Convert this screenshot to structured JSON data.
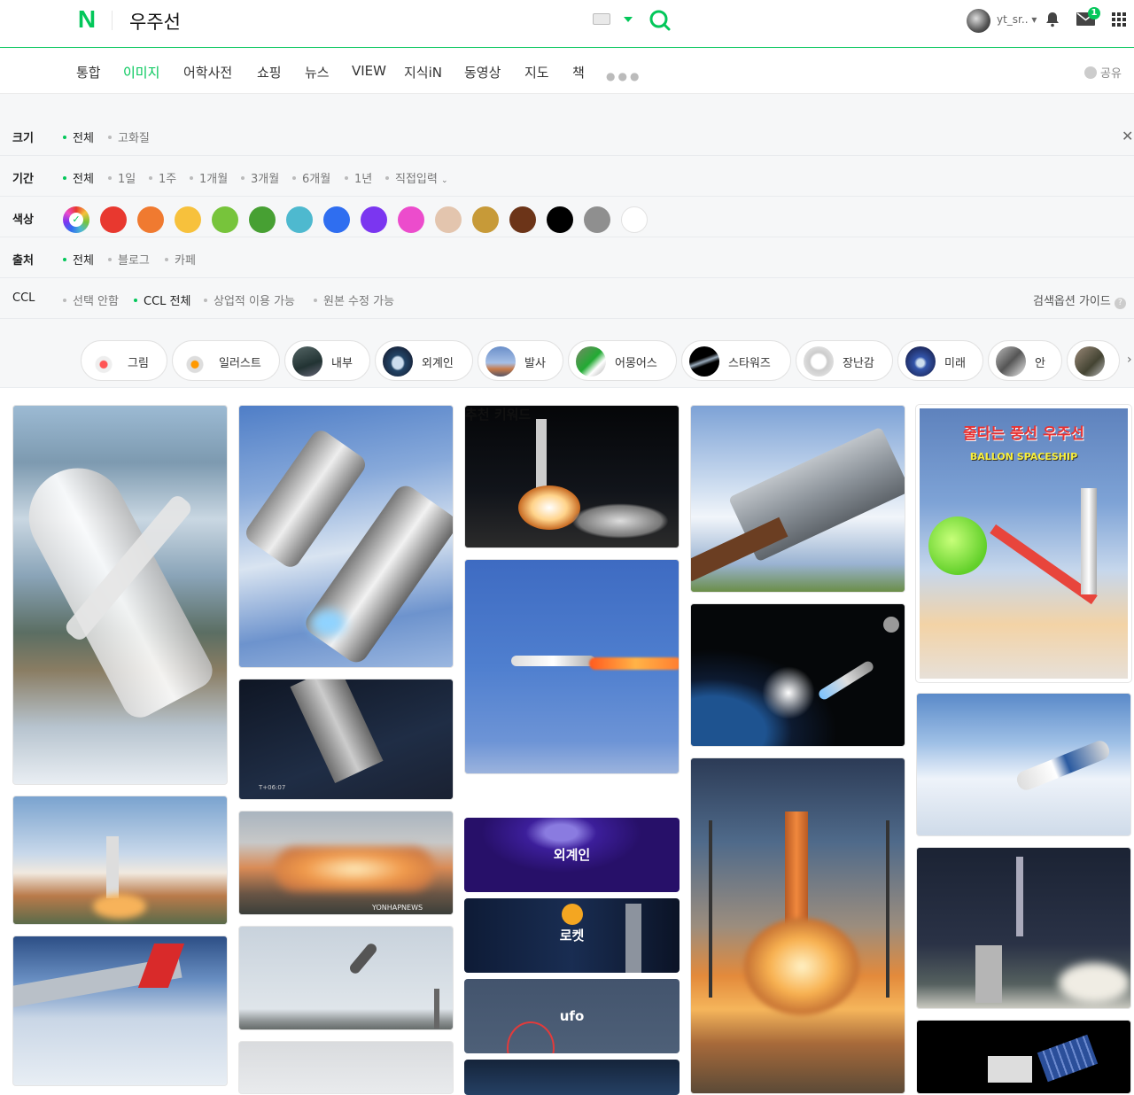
{
  "header": {
    "logo": "N",
    "query": "우주선",
    "user_id": "yt_sr..",
    "mail_count": "1"
  },
  "tabs": [
    "통합",
    "이미지",
    "어학사전",
    "쇼핑",
    "뉴스",
    "VIEW",
    "지식iN",
    "동영상",
    "지도",
    "책"
  ],
  "share_label": "공유",
  "options": {
    "size": {
      "label": "크기",
      "items": [
        "전체",
        "고화질"
      ]
    },
    "period": {
      "label": "기간",
      "items": [
        "전체",
        "1일",
        "1주",
        "1개월",
        "3개월",
        "6개월",
        "1년",
        "직접입력"
      ]
    },
    "color": {
      "label": "색상",
      "swatches": [
        "#e8382f",
        "#f07a30",
        "#f7c13c",
        "#77c43b",
        "#47a033",
        "#4eb9cf",
        "#2f6ef0",
        "#7b36f0",
        "#ec4ccc",
        "#e3c5ae",
        "#c79a38",
        "#6c3418",
        "#000000",
        "#8f8f8f",
        "#ffffff"
      ]
    },
    "source": {
      "label": "출처",
      "items": [
        "전체",
        "블로그",
        "카페"
      ]
    },
    "ccl": {
      "label": "CCL",
      "items": [
        "선택 안함",
        "CCL 전체",
        "상업적 이용 가능",
        "원본 수정 가능"
      ],
      "guide": "검색옵션 가이드"
    }
  },
  "related": [
    "그림",
    "일러스트",
    "내부",
    "외계인",
    "발사",
    "어몽어스",
    "스타워즈",
    "장난감",
    "미래",
    "안"
  ],
  "recommend": {
    "title": "추천 키워드",
    "keywords": [
      "외계인",
      "로켓",
      "ufo"
    ]
  },
  "poster": {
    "title": "줄타는 풍선 우주선",
    "subtitle": "BALLON SPACESHIP"
  },
  "watermark": "T+06:07",
  "credit": "YONHAPNEWS"
}
